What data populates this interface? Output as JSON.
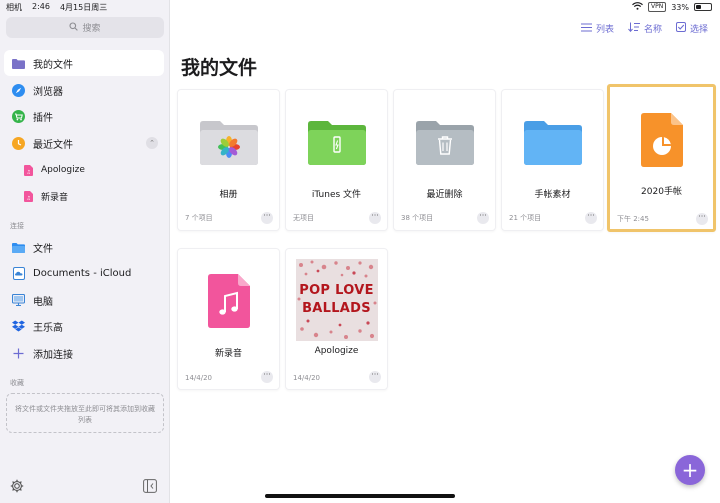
{
  "status": {
    "app": "相机",
    "time": "2:46",
    "date": "4月15日周三",
    "vpn": "VPN",
    "battery": "33%",
    "battery_level": 0.33
  },
  "sidebar": {
    "search_placeholder": "搜索",
    "items": [
      {
        "label": "我的文件"
      },
      {
        "label": "浏览器"
      },
      {
        "label": "插件"
      },
      {
        "label": "最近文件"
      },
      {
        "label": "Apologize"
      },
      {
        "label": "新录音"
      }
    ],
    "connections_title": "连接",
    "connections": [
      {
        "label": "文件"
      },
      {
        "label": "Documents - iCloud"
      },
      {
        "label": "电脑"
      },
      {
        "label": "王乐高"
      },
      {
        "label": "添加连接"
      }
    ],
    "favorites_title": "收藏",
    "favorites_hint": "将文件或文件夹拖放至此即可将其添加到收藏列表"
  },
  "toolbar": {
    "list": "列表",
    "sort": "名称",
    "select": "选择"
  },
  "main": {
    "title": "我的文件",
    "items": [
      {
        "name": "相册",
        "meta": "7 个项目"
      },
      {
        "name": "iTunes 文件",
        "meta": "无项目"
      },
      {
        "name": "最近删除",
        "meta": "38 个项目"
      },
      {
        "name": "手帐素材",
        "meta": "21 个项目"
      },
      {
        "name": "2020手帐",
        "meta": "下午 2:45"
      },
      {
        "name": "新录音",
        "meta": "14/4/20"
      },
      {
        "name": "Apologize",
        "meta": "14/4/20"
      }
    ],
    "album_text": [
      "POP LOVE",
      "BALLADS"
    ]
  },
  "colors": {
    "accent": "#6c6cd2",
    "fab": "#8a66d9",
    "selection": "#f0c46a",
    "folder_gray": "#c7c7cc",
    "folder_green": "#7ed35a",
    "folder_blue": "#62b4f5",
    "keynote_orange": "#f7922a",
    "audio_pink": "#f2559c"
  }
}
